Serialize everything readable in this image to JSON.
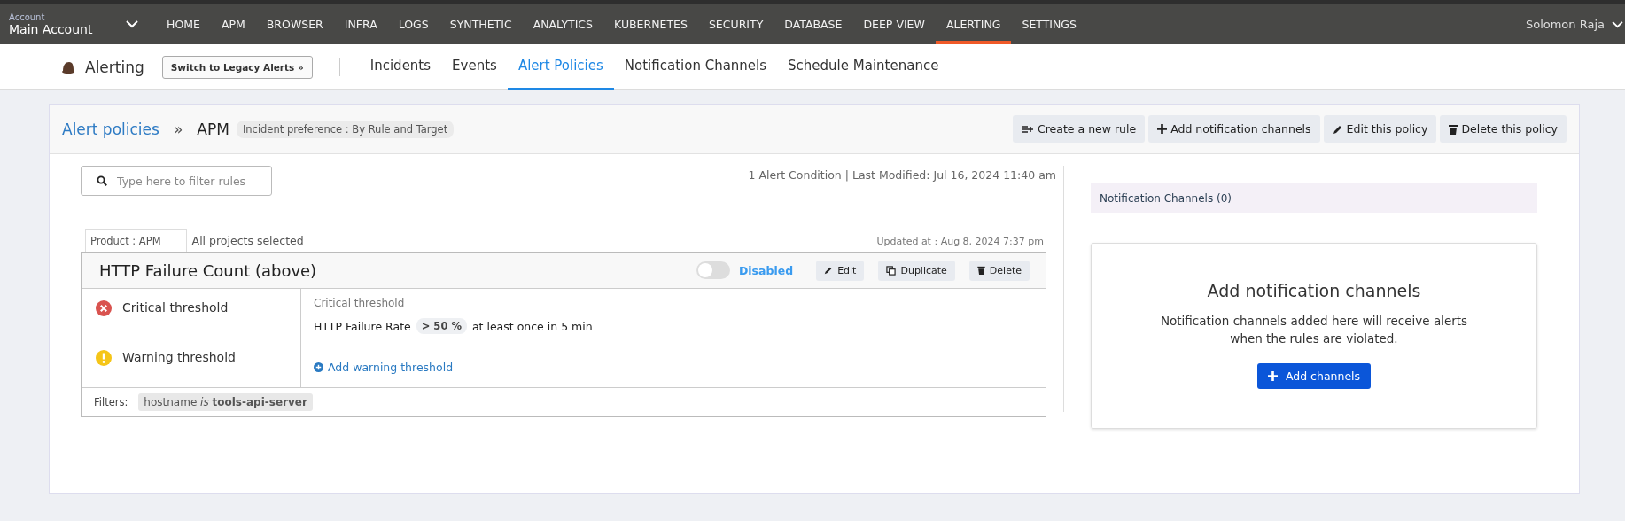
{
  "account": {
    "label": "Account",
    "name": "Main Account"
  },
  "nav": [
    {
      "label": "HOME",
      "selected": false
    },
    {
      "label": "APM",
      "selected": false
    },
    {
      "label": "BROWSER",
      "selected": false
    },
    {
      "label": "INFRA",
      "selected": false
    },
    {
      "label": "LOGS",
      "selected": false
    },
    {
      "label": "SYNTHETIC",
      "selected": false
    },
    {
      "label": "ANALYTICS",
      "selected": false
    },
    {
      "label": "KUBERNETES",
      "selected": false
    },
    {
      "label": "SECURITY",
      "selected": false
    },
    {
      "label": "DATABASE",
      "selected": false
    },
    {
      "label": "DEEP VIEW",
      "selected": false
    },
    {
      "label": "ALERTING",
      "selected": true
    },
    {
      "label": "SETTINGS",
      "selected": false
    }
  ],
  "user": "Solomon Raja",
  "section": {
    "title": "Alerting",
    "legacy_button": "Switch to Legacy Alerts »"
  },
  "tabs": [
    {
      "label": "Incidents",
      "selected": false
    },
    {
      "label": "Events",
      "selected": false
    },
    {
      "label": "Alert Policies",
      "selected": true
    },
    {
      "label": "Notification Channels",
      "selected": false
    },
    {
      "label": "Schedule Maintenance",
      "selected": false
    }
  ],
  "breadcrumb": {
    "link": "Alert policies",
    "separator": "»",
    "current": "APM",
    "badge": "Incident preference : By Rule and Target"
  },
  "actions": [
    {
      "kind": "rule",
      "label": "Create a new rule"
    },
    {
      "kind": "plus",
      "label": "Add notification channels"
    },
    {
      "kind": "edit",
      "label": "Edit this policy"
    },
    {
      "kind": "delete",
      "label": "Delete this policy"
    }
  ],
  "search": {
    "placeholder": "Type here to filter rules"
  },
  "summary": "1 Alert Condition | Last Modified: Jul 16, 2024 11:40 am",
  "product": "Product : APM",
  "projects": "All projects selected",
  "updated": "Updated at : Aug 8, 2024 7:37 pm",
  "rule": {
    "title": "HTTP Failure Count (above)",
    "on": false,
    "status": "Disabled",
    "buttons": [
      {
        "kind": "edit",
        "label": "Edit"
      },
      {
        "kind": "duplicate",
        "label": "Duplicate"
      },
      {
        "kind": "delete",
        "label": "Delete"
      }
    ],
    "thresholds": [
      {
        "kind": "critical",
        "label": "Critical threshold",
        "heading": "Critical threshold",
        "metric": "HTTP Failure Rate",
        "value": "> 50 %",
        "suffix": "at least once in 5 min"
      },
      {
        "kind": "warning",
        "label": "Warning threshold",
        "link": "Add warning threshold"
      }
    ],
    "filters_label": "Filters:",
    "filter": "hostname *is* **tools-api-server**"
  },
  "channels": {
    "header": "Notification Channels (0)",
    "title": "Add notification channels",
    "text": "Notification channels added here will receive alerts when the rules are violated.",
    "button": "Add channels"
  }
}
